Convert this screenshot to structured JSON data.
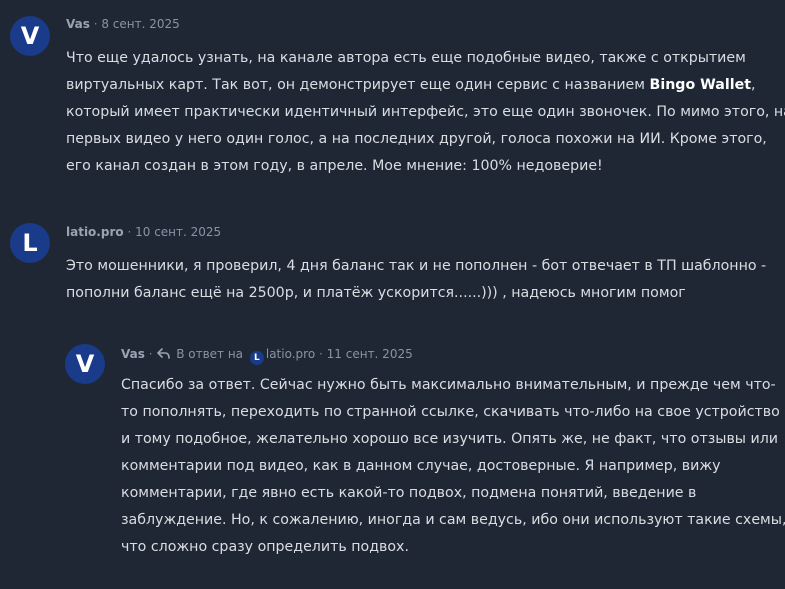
{
  "comments": [
    {
      "avatar_letter": "V",
      "author": "Vas",
      "separator": "·",
      "date": "8 сент. 2025",
      "lines": [
        "Что еще удалось узнать, на канале автора есть еще подобные видео, также с открытием",
        "виртуальных карт. Так вот, он демонстрирует еще один сервис с названием ",
        "Bingo Wallet",
        ",",
        "который имеет практически идентичный интерфейс, это еще один звоночек. По мимо этого, на",
        "первых видео у него один голос, а на последних другой, голоса похожи на ИИ. Кроме этого,",
        "его канал создан в этом году, в апреле. Мое мнение: 100% недоверие!"
      ]
    },
    {
      "avatar_letter": "L",
      "author": "latio.pro",
      "separator": "·",
      "date": "10 сент. 2025",
      "lines": [
        "Это мошенники, я проверил, 4 дня баланс так и не пополнен - бот отвечает в ТП шаблонно -",
        "пополни баланс ещё на 2500р, и платёж ускорится......))) , надеюсь многим помог"
      ]
    },
    {
      "avatar_letter": "V",
      "author": "Vas",
      "separator": "·",
      "reply_label": "В ответ на",
      "reply_to_letter": "L",
      "reply_to": "latio.pro",
      "separator2": "·",
      "date": "11 сент. 2025",
      "lines": [
        "Спасибо за ответ. Сейчас нужно быть максимально внимательным, и прежде чем что-",
        "то пополнять, переходить по странной ссылке, скачивать что-либо на свое устройство",
        "и тому подобное, желательно хорошо все изучить. Опять же, не факт, что отзывы или",
        "комментарии под видео, как в данном случае, достоверные. Я например, вижу",
        "комментарии, где явно есть какой-то подвох, подмена понятий, введение в",
        "заблуждение. Но, к сожалению, иногда и сам ведусь, ибо они используют такие схемы,",
        "что сложно сразу определить подвох."
      ]
    }
  ],
  "colors": {
    "background": "#1f2735",
    "avatar": "#1a3a8a",
    "text": "#dadde2",
    "meta": "#8a93a3"
  },
  "icons": {
    "reply": "reply-arrow-icon"
  }
}
